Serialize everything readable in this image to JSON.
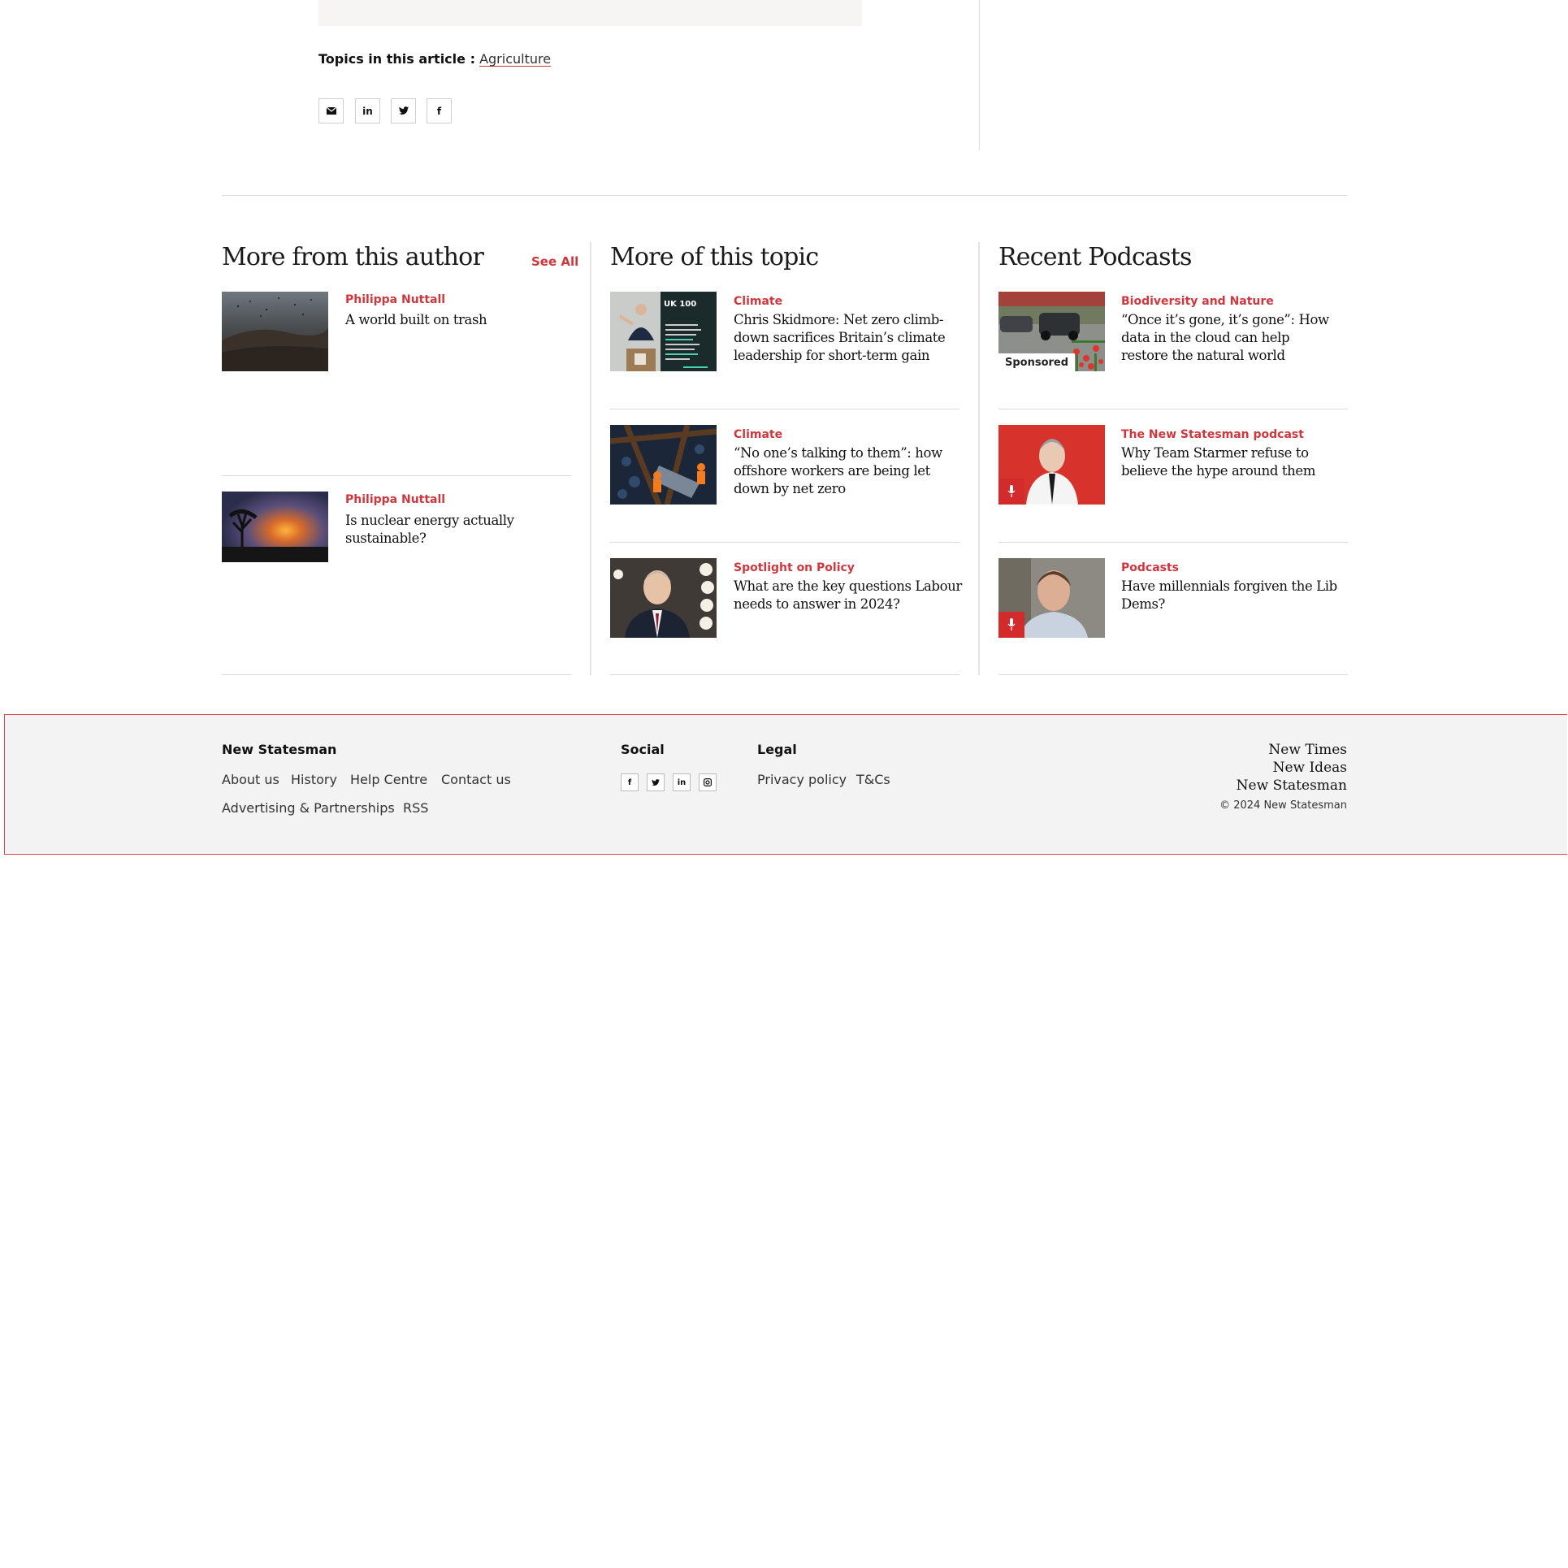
{
  "article_tail": {
    "topics_label": "Topics in this article :",
    "topics": [
      "Agriculture"
    ],
    "share_icons": [
      "email-icon",
      "linkedin-icon",
      "twitter-icon",
      "facebook-icon"
    ],
    "share_glyphs": [
      "✉",
      "in",
      "🐦",
      "f"
    ]
  },
  "author_col": {
    "heading": "More from this author",
    "see_all": "See All",
    "items": [
      {
        "category": "Philippa Nuttall",
        "title": "A world built on trash"
      },
      {
        "category": "Philippa Nuttall",
        "title": "Is nuclear energy actually sustainable?"
      }
    ]
  },
  "topic_col": {
    "heading": "More of this topic",
    "items": [
      {
        "category": "Climate",
        "title": "Chris Skidmore: Net zero climb-down sacrifices Britain’s climate leadership for short-term gain"
      },
      {
        "category": "Climate",
        "title": "“No one’s talking to them”: how offshore workers are being let down by net zero"
      },
      {
        "category": "Spotlight on Policy",
        "title": "What are the key questions Labour needs to answer in 2024?"
      }
    ]
  },
  "podcast_col": {
    "heading": "Recent Podcasts",
    "items": [
      {
        "category": "Biodiversity and Nature",
        "title": "“Once it’s gone, it’s gone”: How data in the cloud can help restore the natural world",
        "badge": "Sponsored"
      },
      {
        "category": "The New Statesman podcast",
        "title": "Why Team Starmer refuse to believe the hype around them"
      },
      {
        "category": "Podcasts",
        "title": "Have millennials forgiven the Lib Dems?"
      }
    ]
  },
  "thumb_texts": {
    "uk100_logo": "UK 100"
  },
  "footer": {
    "new_statesman": {
      "heading": "New Statesman",
      "links_row1": [
        "About us",
        "History",
        "Help Centre",
        "Contact us"
      ],
      "links_row2": [
        "Advertising & Partnerships",
        "RSS"
      ]
    },
    "social": {
      "heading": "Social",
      "icons": [
        "facebook-icon",
        "twitter-icon",
        "linkedin-icon",
        "instagram-icon"
      ],
      "glyphs": [
        "f",
        "🐦",
        "in",
        "◎"
      ]
    },
    "legal": {
      "heading": "Legal",
      "links": [
        "Privacy policy",
        "T&Cs"
      ]
    },
    "brand_lines": [
      "New Times",
      "New Ideas",
      "New Statesman"
    ],
    "copyright": "© 2024 New Statesman"
  },
  "colors": {
    "accent": "#d0373d",
    "footer_bg": "#f3f3f3",
    "footer_border": "#e0454b"
  }
}
